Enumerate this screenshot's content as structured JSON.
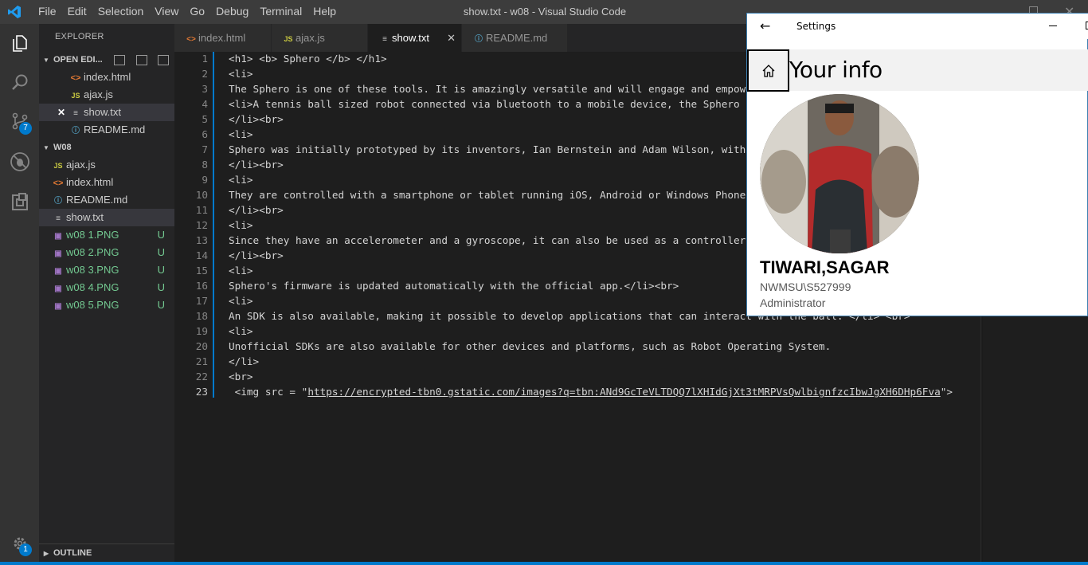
{
  "window": {
    "title": "show.txt - w08 - Visual Studio Code"
  },
  "menu": [
    "File",
    "Edit",
    "Selection",
    "View",
    "Go",
    "Debug",
    "Terminal",
    "Help"
  ],
  "activity": {
    "scm_badge": "7",
    "settings_badge": "1"
  },
  "sidebar": {
    "title": "EXPLORER",
    "open_editors": {
      "header": "OPEN EDI...",
      "items": [
        "index.html",
        "ajax.js",
        "show.txt",
        "README.md"
      ]
    },
    "folder": {
      "header": "W08",
      "items": [
        "ajax.js",
        "index.html",
        "README.md",
        "show.txt",
        "w08 1.PNG",
        "w08 2.PNG",
        "w08 3.PNG",
        "w08 4.PNG",
        "w08 5.PNG"
      ],
      "untracked_label": "U"
    },
    "outline": "OUTLINE"
  },
  "tabs": [
    "index.html",
    "ajax.js",
    "show.txt",
    "README.md"
  ],
  "editor": {
    "line_numbers": [
      "1",
      "2",
      "3",
      "4",
      "5",
      "6",
      "7",
      "8",
      "9",
      "10",
      "11",
      "12",
      "13",
      "14",
      "15",
      "16",
      "17",
      "18",
      "19",
      "20",
      "21",
      "22",
      "23"
    ],
    "lines": [
      "<h1> <b> Sphero </b> </h1>",
      "<li>",
      "The Sphero is one of these tools. It is amazingly versatile and will engage and empow",
      "<li>A tennis ball sized robot connected via bluetooth to a mobile device, the Sphero",
      "</li><br>",
      "<li>",
      "Sphero was initially prototyped by its inventors, Ian Bernstein and Adam Wilson, with",
      "</li><br>",
      "<li>",
      "They are controlled with a smartphone or tablet running iOS, Android or Windows Phone",
      "</li><br>",
      "<li>",
      "Since they have an accelerometer and a gyroscope, it can also be used as a controller",
      "</li><br>",
      "<li>",
      "Sphero's firmware is updated automatically with the official app.</li><br>",
      "<li>",
      "An SDK is also available, making it possible to develop applications that can interact with the ball. </li> <br>",
      "<li>",
      "Unofficial SDKs are also available for other devices and platforms, such as Robot Operating System.",
      "</li>",
      "<br>"
    ],
    "last_line_prefix": " <img src = \"",
    "last_line_url": "https://encrypted-tbn0.gstatic.com/images?q=tbn:ANd9GcTeVLTDQQ7lXHIdGjXt3tMRPVsQwlbignfzcIbwJgXH6DHp6Fva",
    "last_line_suffix": "\">"
  },
  "settings": {
    "title": "Settings",
    "heading": "Your info",
    "name": "TIWARI,SAGAR",
    "account": "NWMSU\\S527999",
    "role": "Administrator"
  },
  "colors": {
    "accent": "#007acc",
    "untracked": "#73c991"
  }
}
